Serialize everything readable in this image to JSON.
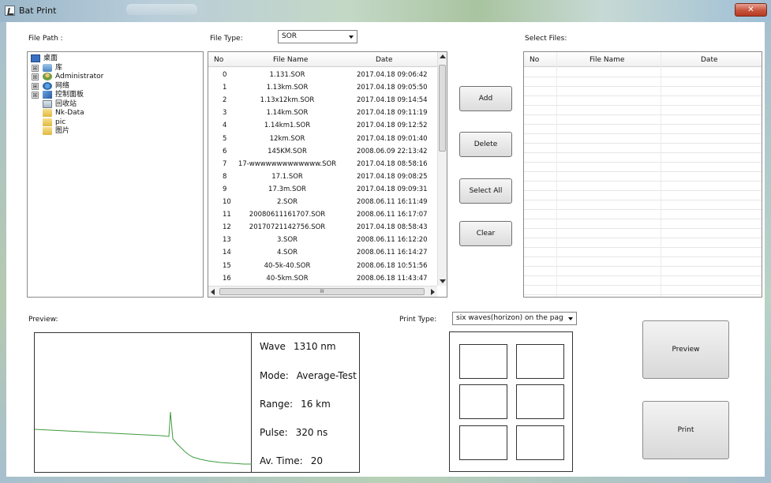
{
  "window": {
    "title": "Bat Print",
    "close_glyph": "✕"
  },
  "file_path": {
    "label": "File Path :"
  },
  "file_type": {
    "label": "File Type:",
    "selected": "SOR"
  },
  "select_files": {
    "label": "Select Files:"
  },
  "tree": {
    "items": [
      {
        "label": "桌面",
        "icon": "desktop-icon",
        "expander": ""
      },
      {
        "label": "库",
        "icon": "library-icon",
        "expander": "⊞"
      },
      {
        "label": "Administrator",
        "icon": "user-folder-icon",
        "expander": "⊞"
      },
      {
        "label": "网络",
        "icon": "network-icon",
        "expander": "⊞"
      },
      {
        "label": "控制面板",
        "icon": "control-panel-icon",
        "expander": "⊞"
      },
      {
        "label": "回收站",
        "icon": "recycle-bin-icon",
        "expander": ""
      },
      {
        "label": "Nk-Data",
        "icon": "folder-icon",
        "expander": ""
      },
      {
        "label": "pic",
        "icon": "folder-icon",
        "expander": ""
      },
      {
        "label": "图片",
        "icon": "folder-icon",
        "expander": ""
      }
    ]
  },
  "file_table": {
    "headers": {
      "no": "No",
      "name": "File Name",
      "date": "Date"
    },
    "rows": [
      {
        "no": "0",
        "name": "1.131.SOR",
        "date": "2017.04.18  09:06:42"
      },
      {
        "no": "1",
        "name": "1.13km.SOR",
        "date": "2017.04.18  09:05:50"
      },
      {
        "no": "2",
        "name": "1.13x12km.SOR",
        "date": "2017.04.18  09:14:54"
      },
      {
        "no": "3",
        "name": "1.14km.SOR",
        "date": "2017.04.18  09:11:19"
      },
      {
        "no": "4",
        "name": "1.14km1.SOR",
        "date": "2017.04.18  09:12:52"
      },
      {
        "no": "5",
        "name": "12km.SOR",
        "date": "2017.04.18  09:01:40"
      },
      {
        "no": "6",
        "name": "145KM.SOR",
        "date": "2008.06.09  22:13:42"
      },
      {
        "no": "7",
        "name": "17-wwwwwwwwwwwww.SOR",
        "date": "2017.04.18  08:58:16"
      },
      {
        "no": "8",
        "name": "17.1.SOR",
        "date": "2017.04.18  09:08:25"
      },
      {
        "no": "9",
        "name": "17.3m.SOR",
        "date": "2017.04.18  09:09:31"
      },
      {
        "no": "10",
        "name": "2.SOR",
        "date": "2008.06.11  16:11:49"
      },
      {
        "no": "11",
        "name": "20080611161707.SOR",
        "date": "2008.06.11  16:17:07"
      },
      {
        "no": "12",
        "name": "20170721142756.SOR",
        "date": "2017.04.18  08:58:43"
      },
      {
        "no": "13",
        "name": "3.SOR",
        "date": "2008.06.11  16:12:20"
      },
      {
        "no": "14",
        "name": "4.SOR",
        "date": "2008.06.11  16:14:27"
      },
      {
        "no": "15",
        "name": "40-5k-40.SOR",
        "date": "2008.06.18  10:51:56"
      },
      {
        "no": "16",
        "name": "40-5km.SOR",
        "date": "2008.06.18  11:43:47"
      }
    ]
  },
  "select_table": {
    "headers": {
      "no": "No",
      "name": "File Name",
      "date": "Date"
    }
  },
  "buttons": {
    "add": "Add",
    "delete": "Delete",
    "select_all": "Select All",
    "clear": "Clear",
    "preview": "Preview",
    "print": "Print"
  },
  "hscroll_grip": "III",
  "preview": {
    "label": "Preview:",
    "wave_label": "Wave",
    "wave_value": "1310 nm",
    "mode_label": "Mode:",
    "mode_value": "Average-Test",
    "range_label": "Range:",
    "range_value": "16 km",
    "pulse_label": "Pulse:",
    "pulse_value": "320 ns",
    "avtime_label": "Av. Time:",
    "avtime_value": "20"
  },
  "print_type": {
    "label": "Print Type:",
    "selected": "six waves(horizon) on the pag"
  },
  "colors": {
    "trace": "#3d9b3d",
    "border": "#8a8a8a",
    "close_red": "#c7533c"
  }
}
